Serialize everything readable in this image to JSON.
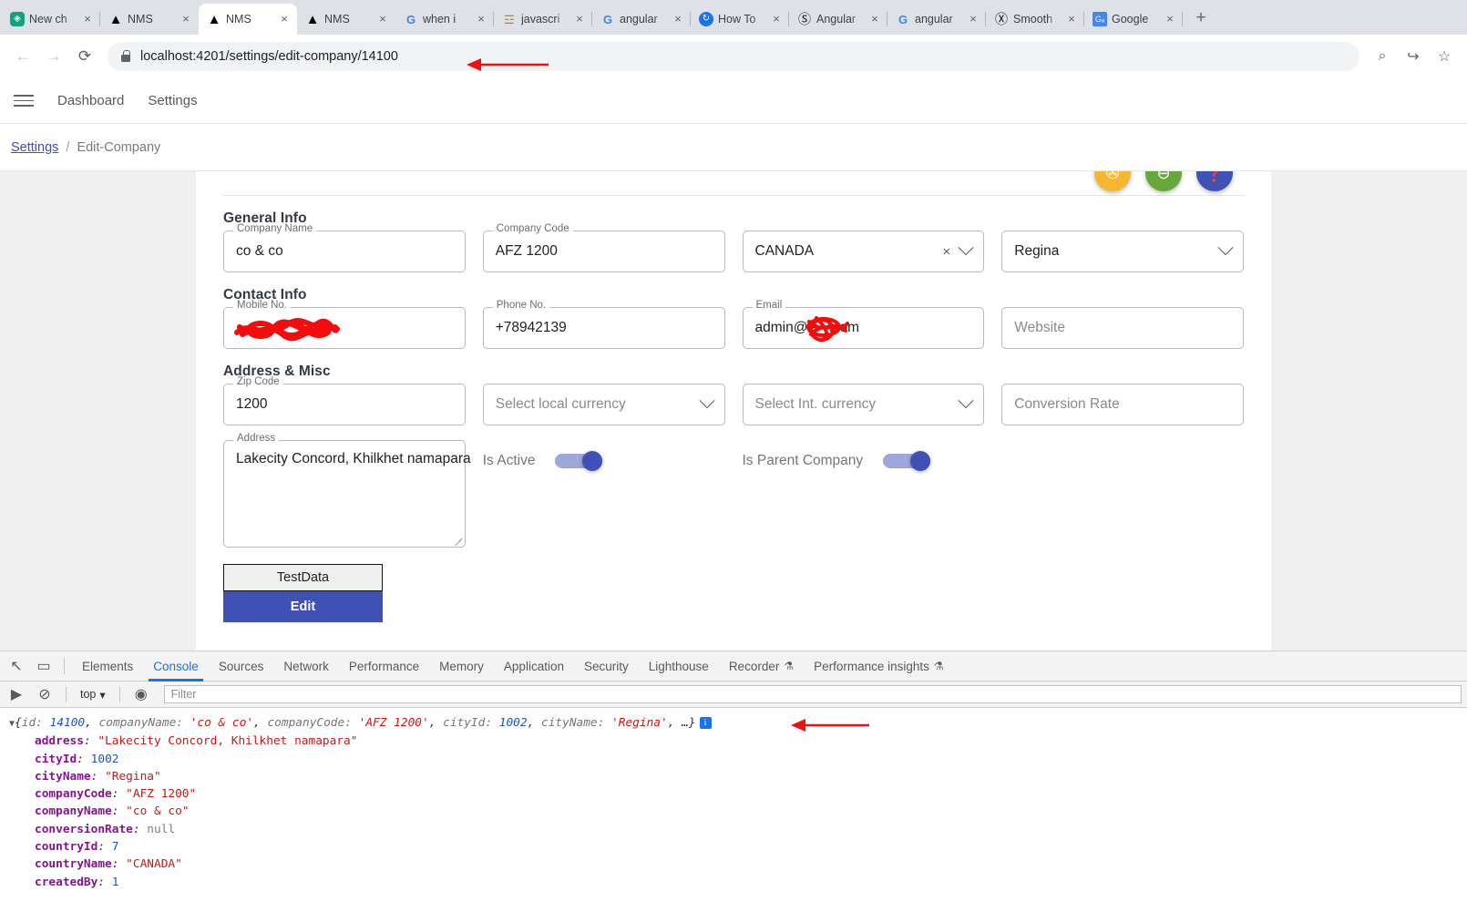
{
  "browser": {
    "tabs": [
      {
        "title": "New ch",
        "favicon": "openai-icon",
        "fav_glyph": "◈",
        "fav_class": "fav-gpt",
        "active": false
      },
      {
        "title": "NMS",
        "favicon": "angular-icon",
        "fav_glyph": "▲",
        "fav_class": "fav-ng",
        "active": false
      },
      {
        "title": "NMS",
        "favicon": "angular-icon",
        "fav_glyph": "▲",
        "fav_class": "fav-ng",
        "active": true
      },
      {
        "title": "NMS",
        "favicon": "angular-icon",
        "fav_glyph": "▲",
        "fav_class": "fav-ng",
        "active": false
      },
      {
        "title": "when i",
        "favicon": "google-icon",
        "fav_glyph": "G",
        "fav_class": "fav-g",
        "active": false
      },
      {
        "title": "javascri",
        "favicon": "javascript-icon",
        "fav_glyph": "☲",
        "fav_class": "fav-js",
        "active": false
      },
      {
        "title": "angular",
        "favicon": "google-icon",
        "fav_glyph": "G",
        "fav_class": "fav-g",
        "active": false
      },
      {
        "title": "How To",
        "favicon": "howto-icon",
        "fav_glyph": "↻",
        "fav_class": "fav-howto",
        "active": false
      },
      {
        "title": "Angular",
        "favicon": "stackblitz-icon",
        "fav_glyph": "Ⓢ",
        "fav_class": "fav-circ",
        "active": false
      },
      {
        "title": "angular",
        "favicon": "google-icon",
        "fav_glyph": "G",
        "fav_class": "fav-g",
        "active": false
      },
      {
        "title": "Smooth",
        "favicon": "xcircle-icon",
        "fav_glyph": "Ⓧ",
        "fav_class": "fav-circ",
        "active": false
      },
      {
        "title": "Google",
        "favicon": "google-translate-icon",
        "fav_glyph": "Gₐ",
        "fav_class": "fav-gt",
        "active": false
      }
    ],
    "close_label": "×",
    "new_tab_label": "+",
    "back_label": "←",
    "forward_label": "→",
    "reload_label": "⟳",
    "url": "localhost:4201/settings/edit-company/14100",
    "zoom_icon_label": "⌕",
    "share_icon_label": "↪",
    "bookmark_icon_label": "☆"
  },
  "app_nav": {
    "menu_label": "☰",
    "links": [
      {
        "label": "Dashboard"
      },
      {
        "label": "Settings"
      }
    ]
  },
  "breadcrumb": {
    "root": "Settings",
    "separator": "/",
    "current": "Edit-Company"
  },
  "fabs": [
    {
      "name": "filter-off-icon",
      "color": "#f5b731",
      "glyph": "✇"
    },
    {
      "name": "minus-circle-icon",
      "color": "#67a83a",
      "glyph": "⊖"
    },
    {
      "name": "help-icon",
      "color": "#3f51b5",
      "glyph": "❓"
    }
  ],
  "form": {
    "sections": [
      {
        "title": "General Info"
      },
      {
        "title": "Contact Info"
      },
      {
        "title": "Address & Misc"
      }
    ],
    "general": {
      "company_name": {
        "label": "Company Name",
        "value": "co & co"
      },
      "company_code": {
        "label": "Company Code",
        "value": "AFZ 1200"
      },
      "country": {
        "value": "CANADA",
        "clear_icon": "×"
      },
      "city": {
        "value": "Regina"
      }
    },
    "contact": {
      "mobile": {
        "label": "Mobile No.",
        "value": "",
        "redacted": true
      },
      "phone": {
        "label": "Phone No.",
        "value": "+78942139"
      },
      "email": {
        "label": "Email",
        "value": "admin@la        y.com",
        "redacted": true
      },
      "website": {
        "placeholder": "Website"
      }
    },
    "address": {
      "zip": {
        "label": "Zip Code",
        "value": "1200"
      },
      "local_currency": {
        "placeholder": "Select local currency"
      },
      "int_currency": {
        "placeholder": "Select Int. currency"
      },
      "conversion_rate": {
        "placeholder": "Conversion Rate"
      },
      "address_field": {
        "label": "Address",
        "value": "Lakecity Concord, Khilkhet namapara"
      },
      "is_active": {
        "label": "Is Active",
        "on": true
      },
      "is_parent": {
        "label": "Is Parent Company",
        "on": true
      }
    },
    "buttons": {
      "testdata": "TestData",
      "edit": "Edit"
    }
  },
  "devtools": {
    "inspect_icon": "↖",
    "device_icon": "▭",
    "tabs": [
      {
        "label": "Elements",
        "active": false,
        "flask": false
      },
      {
        "label": "Console",
        "active": true,
        "flask": false
      },
      {
        "label": "Sources",
        "active": false,
        "flask": false
      },
      {
        "label": "Network",
        "active": false,
        "flask": false
      },
      {
        "label": "Performance",
        "active": false,
        "flask": false
      },
      {
        "label": "Memory",
        "active": false,
        "flask": false
      },
      {
        "label": "Application",
        "active": false,
        "flask": false
      },
      {
        "label": "Security",
        "active": false,
        "flask": false
      },
      {
        "label": "Lighthouse",
        "active": false,
        "flask": false
      },
      {
        "label": "Recorder",
        "active": false,
        "flask": true
      },
      {
        "label": "Performance insights",
        "active": false,
        "flask": true
      }
    ],
    "flask_glyph": "⚗",
    "filterbar": {
      "execute_icon": "▶",
      "clear_icon": "⊘",
      "context": "top",
      "context_caret": "▾",
      "eye_icon": "◉",
      "filter_placeholder": "Filter"
    },
    "console": {
      "preview": {
        "triangle": "▼",
        "open_brace": "{",
        "close": ", …}",
        "entries": [
          {
            "key": "id",
            "value": "14100",
            "type": "number"
          },
          {
            "key": "companyName",
            "value": "'co & co'",
            "type": "string"
          },
          {
            "key": "companyCode",
            "value": "'AFZ 1200'",
            "type": "string"
          },
          {
            "key": "cityId",
            "value": "1002",
            "type": "number"
          },
          {
            "key": "cityName",
            "value": "'Regina'",
            "type": "string"
          }
        ],
        "info_badge": "i"
      },
      "properties": [
        {
          "key": "address",
          "value": "\"Lakecity Concord, Khilkhet namapara\"",
          "type": "string"
        },
        {
          "key": "cityId",
          "value": "1002",
          "type": "number"
        },
        {
          "key": "cityName",
          "value": "\"Regina\"",
          "type": "string"
        },
        {
          "key": "companyCode",
          "value": "\"AFZ 1200\"",
          "type": "string"
        },
        {
          "key": "companyName",
          "value": "\"co & co\"",
          "type": "string"
        },
        {
          "key": "conversionRate",
          "value": "null",
          "type": "null"
        },
        {
          "key": "countryId",
          "value": "7",
          "type": "number"
        },
        {
          "key": "countryName",
          "value": "\"CANADA\"",
          "type": "string"
        },
        {
          "key": "createdBy",
          "value": "1",
          "type": "number"
        }
      ]
    }
  }
}
